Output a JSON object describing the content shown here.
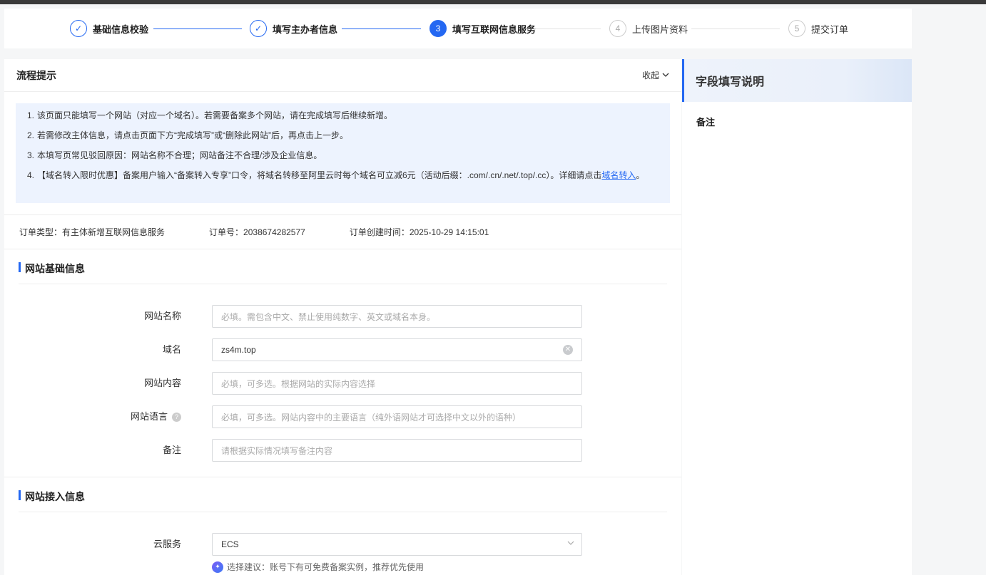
{
  "steps": [
    {
      "label": "基础信息校验",
      "mark": "✓",
      "state": "done"
    },
    {
      "label": "填写主办者信息",
      "mark": "✓",
      "state": "done"
    },
    {
      "label": "填写互联网信息服务",
      "mark": "3",
      "state": "active"
    },
    {
      "label": "上传图片资料",
      "mark": "4",
      "state": "todo"
    },
    {
      "label": "提交订单",
      "mark": "5",
      "state": "todo"
    }
  ],
  "process": {
    "title": "流程提示",
    "collapse_label": "收起",
    "tips": [
      {
        "num": "1.",
        "text": "该页面只能填写一个网站（对应一个域名）。若需要备案多个网站，请在完成填写后继续新增。"
      },
      {
        "num": "2.",
        "text": "若需修改主体信息，请点击页面下方“完成填写”或“删除此网站”后，再点击上一步。"
      },
      {
        "num": "3.",
        "text": "本填写页常见驳回原因：网站名称不合理；网站备注不合理/涉及企业信息。"
      },
      {
        "num": "4.",
        "text": "【域名转入限时优惠】备案用户输入“备案转入专享”口令，将域名转移至阿里云时每个域名可立减6元（活动后缀：.com/.cn/.net/.top/.cc）。详细请点击",
        "link": "域名转入",
        "tail": "。"
      }
    ]
  },
  "order": {
    "type_label": "订单类型：",
    "type_value": "有主体新增互联网信息服务",
    "no_label": "订单号：",
    "no_value": "2038674282577",
    "time_label": "订单创建时间：",
    "time_value": "2025-10-29 14:15:01"
  },
  "site_basic": {
    "title": "网站基础信息",
    "name_label": "网站名称",
    "name_placeholder": "必填。需包含中文、禁止使用纯数字、英文或域名本身。",
    "domain_label": "域名",
    "domain_value": "zs4m.top",
    "content_label": "网站内容",
    "content_placeholder": "必填，可多选。根据网站的实际内容选择",
    "lang_label": "网站语言",
    "lang_placeholder": "必填，可多选。网站内容中的主要语言（纯外语网站才可选择中文以外的语种）",
    "remark_label": "备注",
    "remark_placeholder": "请根据实际情况填写备注内容"
  },
  "site_access": {
    "title": "网站接入信息",
    "cloud_label": "云服务",
    "cloud_value": "ECS",
    "suggest": "选择建议：账号下有可免费备案实例，推荐优先使用"
  },
  "sidebar": {
    "title": "字段填写说明",
    "item": "备注"
  }
}
